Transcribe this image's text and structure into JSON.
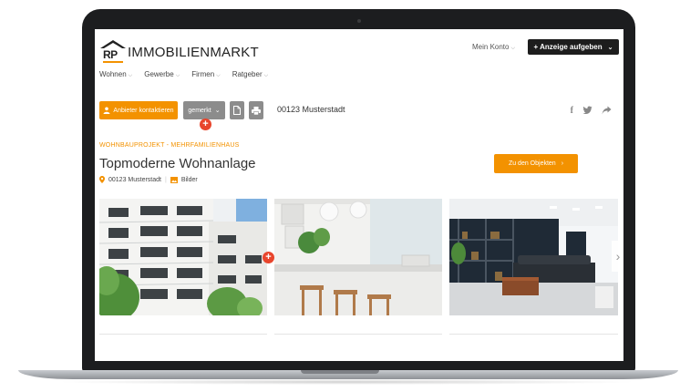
{
  "header": {
    "logo_mark": "RP",
    "logo_text": "IMMOBILIENMARKT",
    "account_label": "Mein Konto",
    "cta_label": "+ Anzeige aufgeben"
  },
  "nav": {
    "items": [
      {
        "label": "Wohnen"
      },
      {
        "label": "Gewerbe"
      },
      {
        "label": "Firmen"
      },
      {
        "label": "Ratgeber"
      }
    ]
  },
  "toolbar": {
    "contact_label": "Anbieter kontaktieren",
    "saved_label": "gemerkt",
    "location": "00123 Musterstadt"
  },
  "listing": {
    "category": "WOHNBAUPROJEKT - MEHRFAMILIENHAUS",
    "title": "Topmoderne Wohnanlage",
    "location": "00123 Musterstadt",
    "images_label": "Bilder",
    "objects_button": "Zu den Objekten"
  },
  "colors": {
    "accent": "#f39200",
    "badge": "#e8452c",
    "dark": "#1d1d1d",
    "grey_button": "#8c8c8c"
  },
  "icons": [
    "user-icon",
    "chevron-down-icon",
    "pdf-icon",
    "print-icon",
    "facebook-icon",
    "twitter-icon",
    "share-icon",
    "map-pin-icon",
    "image-icon",
    "chevron-right-icon",
    "plus-icon"
  ]
}
